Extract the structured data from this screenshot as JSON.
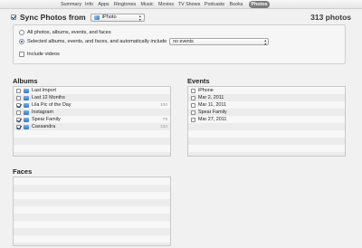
{
  "tabs": [
    {
      "label": "Summary",
      "active": false
    },
    {
      "label": "Info",
      "active": false
    },
    {
      "label": "Apps",
      "active": false
    },
    {
      "label": "Ringtones",
      "active": false
    },
    {
      "label": "Music",
      "active": false
    },
    {
      "label": "Movies",
      "active": false
    },
    {
      "label": "TV Shows",
      "active": false
    },
    {
      "label": "Podcasts",
      "active": false
    },
    {
      "label": "Books",
      "active": false
    },
    {
      "label": "Photos",
      "active": true
    }
  ],
  "sync": {
    "checked": true,
    "title": "Sync Photos from",
    "source": "iPhoto",
    "count": "313 photos"
  },
  "options": {
    "all_label": "All photos, albums, events, and faces",
    "selected_label": "Selected albums, events, and faces, and automatically include",
    "events_select": "no events",
    "include_videos_label": "Include videos",
    "include_videos_checked": false,
    "mode": "selected"
  },
  "albums": {
    "title": "Albums",
    "items": [
      {
        "label": "Last Import",
        "checked": false,
        "count": ""
      },
      {
        "label": "Last 12 Months",
        "checked": false,
        "count": ""
      },
      {
        "label": "Lila Pic of the Day",
        "checked": true,
        "count": "100"
      },
      {
        "label": "Instagram",
        "checked": false,
        "count": ""
      },
      {
        "label": "Spear Family",
        "checked": true,
        "count": "79"
      },
      {
        "label": "Cassandra",
        "checked": true,
        "count": "134"
      }
    ]
  },
  "events": {
    "title": "Events",
    "items": [
      {
        "label": "iPhone",
        "checked": false
      },
      {
        "label": "Mar 2, 2011",
        "checked": false
      },
      {
        "label": "Mar 11, 2011",
        "checked": false
      },
      {
        "label": "Spear Family",
        "checked": false
      },
      {
        "label": "Mar 27, 2011",
        "checked": false
      }
    ]
  },
  "faces": {
    "title": "Faces",
    "items": []
  }
}
